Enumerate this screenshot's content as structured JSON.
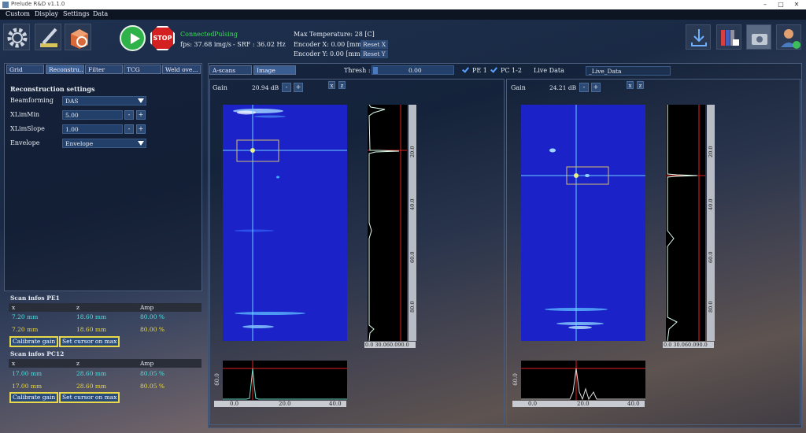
{
  "window": {
    "title": "Prelude R&D v1.1.0"
  },
  "menu": [
    "Custom",
    "Display",
    "Settings",
    "Data"
  ],
  "status": {
    "connection": "Connected",
    "pulsing": "Pulsing",
    "fps": "fps: 37.68 img/s",
    "srf": "- SRF : 36.02 Hz",
    "max_temp": "Max Temperature: 28 [C]",
    "enc_x": "Encoder X: 0.00 [mm]",
    "enc_y": "Encoder Y: 0.00 [mm]",
    "reset_x": "Reset X",
    "reset_y": "Reset Y",
    "stop_label": "STOP"
  },
  "left_tabs": [
    "Grid",
    "Reconstru...",
    "Filter",
    "TCG",
    "Weld ove..."
  ],
  "recon": {
    "title": "Reconstruction settings",
    "beamforming_label": "Beamforming",
    "beamforming": "DAS",
    "xlimmin_label": "XLimMin",
    "xlimmin": "5.00",
    "xlimslope_label": "XLimSlope",
    "xlimslope": "1.00",
    "envelope_label": "Envelope",
    "envelope": "Envelope",
    "minus": "-",
    "plus": "+"
  },
  "scan_pe1": {
    "title": "Scan infos PE1",
    "headers": [
      "x",
      "z",
      "Amp"
    ],
    "rows": [
      [
        "7.20 mm",
        "18.60 mm",
        "80.00 %"
      ],
      [
        "7.20 mm",
        "18.60 mm",
        "80.00 %"
      ]
    ],
    "calibrate": "Calibrate gain",
    "cursor": "Set cursor on max"
  },
  "scan_pc12": {
    "title": "Scan infos PC12",
    "headers": [
      "x",
      "z",
      "Amp"
    ],
    "rows": [
      [
        "17.00 mm",
        "28.60 mm",
        "80.05 %"
      ],
      [
        "17.00 mm",
        "28.60 mm",
        "80.05 %"
      ]
    ],
    "calibrate": "Calibrate gain",
    "cursor": "Set cursor on max"
  },
  "right_tabs": [
    "A-scans",
    "Image"
  ],
  "thresh": {
    "label": "Thresh :",
    "value": "0.00"
  },
  "checks": {
    "pe1": "PE 1",
    "pc12": "PC 1-2"
  },
  "live": {
    "label": "Live Data",
    "value": "_Live_Data"
  },
  "view1": {
    "gain_label": "Gain",
    "gain": "20.94 dB",
    "x": "x",
    "z": "z",
    "yticks": [
      "20.0",
      "40.0",
      "60.0",
      "80.0"
    ],
    "aticks": "0.0 30.060.090.0",
    "hticks": [
      "0.0",
      "20.0",
      "40.0"
    ],
    "vtick": "60.0"
  },
  "view2": {
    "gain_label": "Gain",
    "gain": "24.21 dB",
    "x": "x",
    "z": "z",
    "yticks": [
      "20.0",
      "40.0",
      "60.0",
      "80.0"
    ],
    "aticks": "0.0 30.060.090.0",
    "hticks": [
      "0.0",
      "20.0",
      "40.0"
    ],
    "vtick": "60.0"
  },
  "colors": {
    "accent": "#2c4a74",
    "connected": "#3ddc5a",
    "cyan": "#4fe0e0",
    "yellow": "#e8d84a",
    "image_blue": "#1a22c8"
  }
}
